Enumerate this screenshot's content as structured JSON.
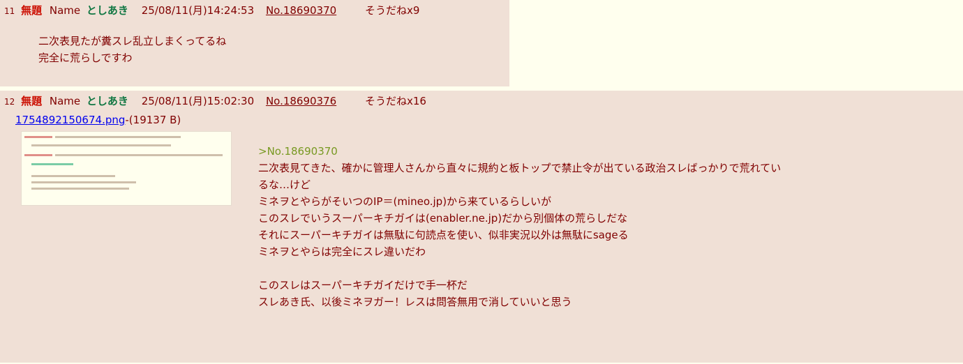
{
  "posts": [
    {
      "num": "11",
      "subject": "無題",
      "name_label": "Name",
      "name": "としあき",
      "date": "25/08/11(月)14:24:53",
      "post_no": "No.18690370",
      "sodane": "そうだねx9",
      "lines": [
        "二次表見たが糞スレ乱立しまくってるね",
        "完全に荒らしですわ"
      ]
    },
    {
      "num": "12",
      "subject": "無題",
      "name_label": "Name",
      "name": "としあき",
      "date": "25/08/11(月)15:02:30",
      "post_no": "No.18690376",
      "sodane": "そうだねx16",
      "file_name": "1754892150674.png",
      "file_size": "-(19137 B)",
      "quote": ">No.18690370",
      "lines": [
        "二次表見てきた、確かに管理人さんから直々に規約と板トップで禁止令が出ている政治スレばっかりで荒れてい",
        "るな…けど",
        "ミネヲとやらがそいつのIP＝(mineo.jp)から来ているらしいが",
        "このスレでいうスーパーキチガイは(enabler.ne.jp)だから別個体の荒らしだな",
        "それにスーパーキチガイは無駄に句読点を使い、似非実況以外は無駄にsageる",
        "ミネヲとやらは完全にスレ違いだわ",
        "",
        "このスレはスーパーキチガイだけで手一杯だ",
        "スレあき氏、以後ミネヲガー！レスは問答無用で消していいと思う"
      ]
    }
  ]
}
